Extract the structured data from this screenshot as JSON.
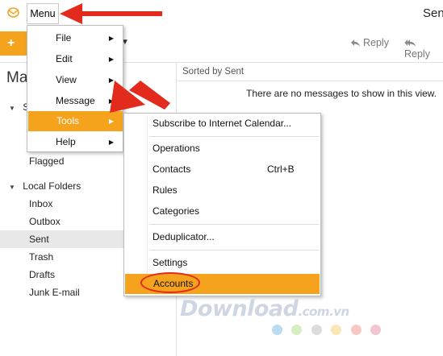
{
  "header": {
    "menu_label": "Menu",
    "title_partial": "Sen"
  },
  "toolbar": {
    "new_button_glyph": "+ N",
    "reply_label": "Reply",
    "reply_all_label": "Reply"
  },
  "sidebar": {
    "title_partial": "Ma",
    "items": [
      {
        "label": "S",
        "expander": true
      },
      {
        "label": "Flagged"
      },
      {
        "label": "Local Folders",
        "expander": true
      },
      {
        "label": "Inbox"
      },
      {
        "label": "Outbox"
      },
      {
        "label": "Sent",
        "selected": true
      },
      {
        "label": "Trash"
      },
      {
        "label": "Drafts"
      },
      {
        "label": "Junk E-mail"
      }
    ]
  },
  "message_list": {
    "sort_label": "Sorted by Sent",
    "empty_text": "There are no messages to show in this view."
  },
  "main_menu": {
    "items": [
      {
        "label": "File",
        "underline": "F"
      },
      {
        "label": "Edit",
        "underline": "E"
      },
      {
        "label": "View",
        "underline": "V"
      },
      {
        "label": "Message",
        "underline": "M"
      },
      {
        "label": "Tools",
        "underline": "T",
        "highlighted": true
      },
      {
        "label": "Help",
        "underline": "H"
      }
    ]
  },
  "tools_menu": {
    "items": [
      {
        "label": "Subscribe to Internet Calendar...",
        "shortcut": ""
      },
      {
        "label": "Operations",
        "shortcut": ""
      },
      {
        "label": "Contacts",
        "shortcut": "Ctrl+B"
      },
      {
        "label": "Rules",
        "shortcut": ""
      },
      {
        "label": "Categories",
        "shortcut": ""
      },
      {
        "label": "Deduplicator...",
        "shortcut": ""
      },
      {
        "label": "Settings",
        "shortcut": ""
      },
      {
        "label": "Accounts",
        "shortcut": "",
        "highlighted": true
      }
    ]
  },
  "watermark": {
    "brand": "Download",
    "suffix": ".com.vn"
  },
  "colors": {
    "accent": "#f5a21c",
    "annotation_red": "#e22a1d",
    "watermark": "#cfd6e3"
  }
}
